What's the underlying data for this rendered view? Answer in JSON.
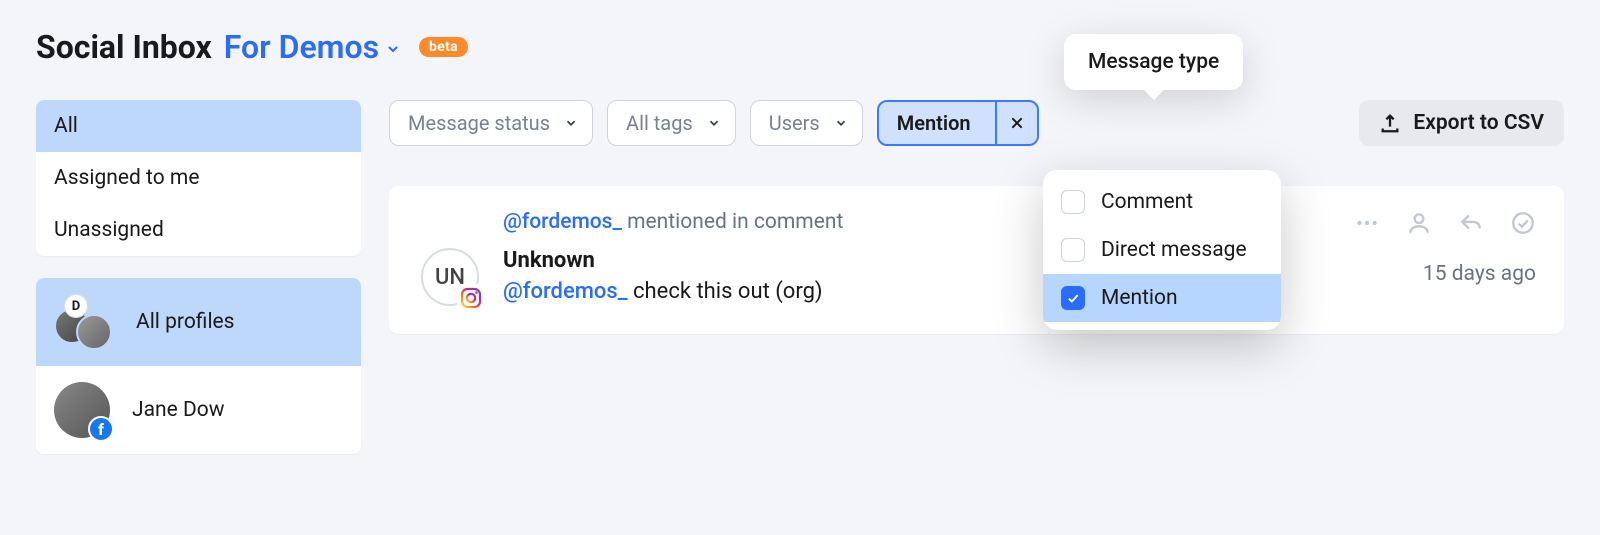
{
  "header": {
    "title": "Social Inbox",
    "selector": "For Demos",
    "badge": "beta"
  },
  "sidebar": {
    "filters": [
      {
        "label": "All",
        "active": true
      },
      {
        "label": "Assigned to me",
        "active": false
      },
      {
        "label": "Unassigned",
        "active": false
      }
    ],
    "profiles": [
      {
        "label": "All profiles",
        "badge_letter": "D",
        "active": true
      },
      {
        "label": "Jane Dow",
        "network": "facebook",
        "active": false
      }
    ]
  },
  "filters": {
    "message_status": "Message status",
    "tags": "All tags",
    "users": "Users",
    "message_type_selected": "Mention",
    "export_label": "Export to CSV",
    "tooltip": "Message type",
    "type_options": [
      {
        "label": "Comment",
        "checked": false
      },
      {
        "label": "Direct message",
        "checked": false
      },
      {
        "label": "Mention",
        "checked": true
      }
    ]
  },
  "message": {
    "handle": "@fordemos_",
    "context_suffix": " mentioned in comment",
    "author": "Unknown",
    "avatar_initials": "UN",
    "body_handle": "@fordemos_",
    "body_rest": " check this out (org)",
    "time": "15 days ago"
  }
}
